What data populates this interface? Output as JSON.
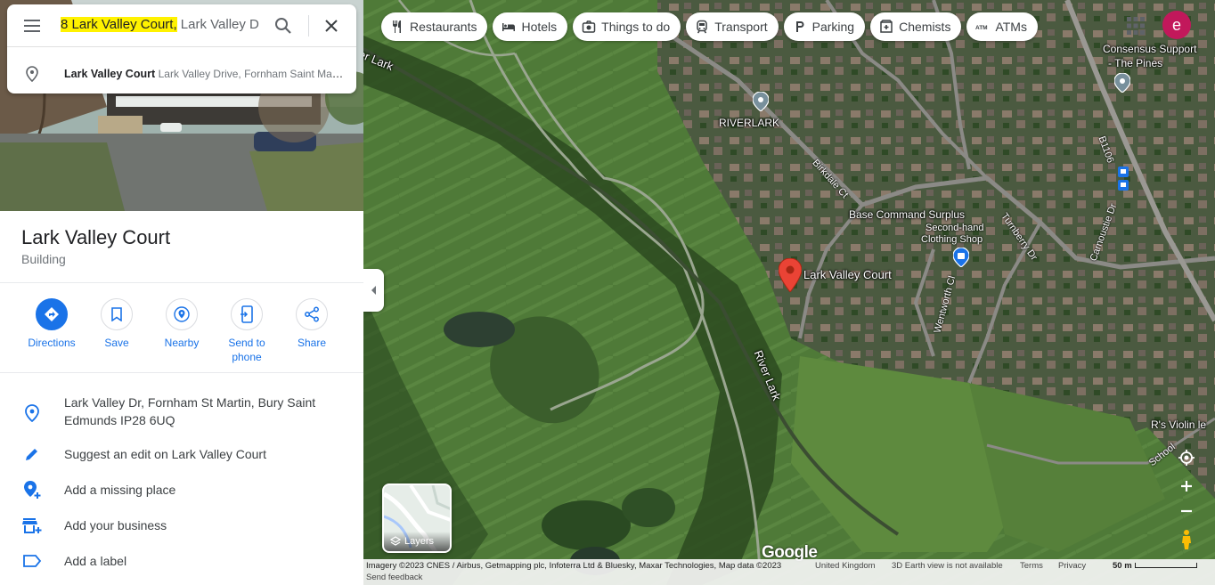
{
  "search": {
    "query_highlight": "8 Lark Valley Court,",
    "query_rest": " Lark Valley D"
  },
  "suggestion": {
    "name": "Lark Valley Court",
    "address": "Lark Valley Drive, Fornham Saint Martin, Bury Saint Edmunds"
  },
  "place": {
    "title": "Lark Valley Court",
    "type": "Building"
  },
  "actions": [
    {
      "label": "Directions",
      "icon": "directions-icon"
    },
    {
      "label": "Save",
      "icon": "bookmark-icon"
    },
    {
      "label": "Nearby",
      "icon": "nearby-icon"
    },
    {
      "label": "Send to phone",
      "icon": "send-to-phone-icon"
    },
    {
      "label": "Share",
      "icon": "share-icon"
    }
  ],
  "info": [
    {
      "text": "Lark Valley Dr, Fornham St Martin, Bury Saint Edmunds IP28 6UQ",
      "icon": "location-pin-icon"
    },
    {
      "text": "Suggest an edit on Lark Valley Court",
      "icon": "edit-pencil-icon"
    },
    {
      "text": "Add a missing place",
      "icon": "add-place-icon"
    },
    {
      "text": "Add your business",
      "icon": "add-business-icon"
    },
    {
      "text": "Add a label",
      "icon": "label-icon"
    }
  ],
  "chips": [
    {
      "label": "Restaurants",
      "icon": "fork-knife-icon"
    },
    {
      "label": "Hotels",
      "icon": "bed-icon"
    },
    {
      "label": "Things to do",
      "icon": "camera-icon"
    },
    {
      "label": "Transport",
      "icon": "train-icon"
    },
    {
      "label": "Parking",
      "icon": "parking-icon"
    },
    {
      "label": "Chemists",
      "icon": "pharmacy-icon"
    },
    {
      "label": "ATMs",
      "icon": "atm-icon"
    }
  ],
  "account": {
    "initial": "e",
    "color": "#c2185b"
  },
  "map": {
    "labels": {
      "lark": "er Lark",
      "riverlark": "RIVERLARK",
      "birkdale": "Birkdale Ct",
      "base_command": "Base Command Surplus",
      "second_hand": "Second-hand",
      "clothing": "Clothing Shop",
      "turnberry": "Turnberry Dr",
      "carnoustie": "Carnoustie Dr",
      "wentworth": "Wentworth Cl",
      "consensus1": "Consensus Support",
      "consensus2": "- The Pines",
      "b1106": "B1106",
      "marker": "Lark Valley Court",
      "river_lark": "River Lark",
      "violin": "R's Violin le",
      "school": "School"
    },
    "layers_label": "Layers",
    "logo": "Google",
    "footer": {
      "imagery": "Imagery ©2023 CNES / Airbus, Getmapping plc, Infoterra Ltd & Bluesky, Maxar Technologies, Map data ©2023",
      "region": "United Kingdom",
      "earth": "3D Earth view is not available",
      "terms": "Terms",
      "privacy": "Privacy",
      "scale": "50 m",
      "feedback": "Send feedback"
    }
  }
}
